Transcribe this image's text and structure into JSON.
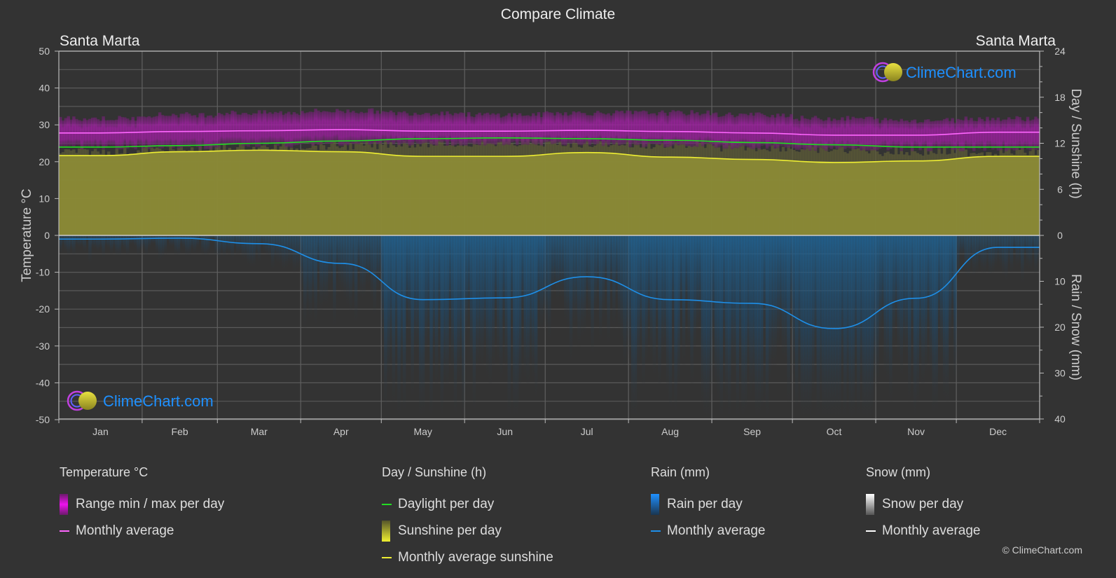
{
  "header": {
    "title": "Compare Climate",
    "location_left": "Santa Marta",
    "location_right": "Santa Marta"
  },
  "watermark": {
    "text": "ClimeChart.com"
  },
  "copyright": "© ClimeChart.com",
  "colors": {
    "background": "#333333",
    "temp_range": "#c21cc4",
    "temp_avg": "#ff66ff",
    "daylight": "#22dd22",
    "sunshine_fill": "#8b8a36",
    "sunshine_avg": "#eeee33",
    "rain_fill": "#1f5f8f",
    "rain_avg": "#1e8fe8",
    "snow_avg": "#ffffff",
    "brand_blue": "#1e90ff"
  },
  "legend": {
    "temperature": {
      "title": "Temperature °C",
      "items": [
        "Range min / max per day",
        "Monthly average"
      ]
    },
    "sunshine": {
      "title": "Day / Sunshine (h)",
      "items": [
        "Daylight per day",
        "Sunshine per day",
        "Monthly average sunshine"
      ]
    },
    "rain": {
      "title": "Rain (mm)",
      "items": [
        "Rain per day",
        "Monthly average"
      ]
    },
    "snow": {
      "title": "Snow (mm)",
      "items": [
        "Snow per day",
        "Monthly average"
      ]
    }
  },
  "chart_data": {
    "type": "line",
    "title": "Compare Climate",
    "categories": [
      "Jan",
      "Feb",
      "Mar",
      "Apr",
      "May",
      "Jun",
      "Jul",
      "Aug",
      "Sep",
      "Oct",
      "Nov",
      "Dec"
    ],
    "axes": {
      "left": {
        "label": "Temperature °C",
        "range": [
          -50,
          50
        ],
        "ticks": [
          50,
          40,
          30,
          20,
          10,
          0,
          -10,
          -20,
          -30,
          -40,
          -50
        ]
      },
      "right_top": {
        "label": "Day / Sunshine (h)",
        "range": [
          0,
          24
        ],
        "ticks": [
          24,
          18,
          12,
          6,
          0
        ]
      },
      "right_bottom": {
        "label": "Rain / Snow (mm)",
        "range": [
          0,
          40
        ],
        "ticks": [
          10,
          20,
          30,
          40
        ]
      }
    },
    "grid": true,
    "legend_position": "bottom",
    "series": [
      {
        "name": "Temperature monthly average (°C)",
        "axis": "left",
        "values": [
          27.8,
          28.2,
          28.4,
          28.7,
          28.3,
          28.3,
          28.5,
          28.2,
          27.8,
          27.2,
          27.2,
          28.0
        ]
      },
      {
        "name": "Temperature daily max (approx °C)",
        "axis": "left",
        "values": [
          31.5,
          32.5,
          33.0,
          33.5,
          33.0,
          32.5,
          33.0,
          33.0,
          32.5,
          31.5,
          31.0,
          31.5
        ]
      },
      {
        "name": "Temperature daily min (approx °C)",
        "axis": "left",
        "values": [
          24.5,
          24.5,
          25.0,
          25.5,
          25.5,
          25.5,
          25.5,
          25.0,
          24.5,
          24.0,
          24.0,
          24.0
        ]
      },
      {
        "name": "Daylight per day (h)",
        "axis": "right_top",
        "values": [
          11.5,
          11.7,
          12.0,
          12.3,
          12.6,
          12.7,
          12.6,
          12.4,
          12.1,
          11.8,
          11.5,
          11.5
        ]
      },
      {
        "name": "Monthly average sunshine (h)",
        "axis": "right_top",
        "values": [
          10.4,
          10.9,
          11.1,
          10.9,
          10.3,
          10.3,
          10.8,
          10.2,
          9.9,
          9.5,
          9.7,
          10.3
        ]
      },
      {
        "name": "Rain monthly average (mm)",
        "axis": "right_bottom",
        "values": [
          0.8,
          0.6,
          1.8,
          6.1,
          14.0,
          13.6,
          9.0,
          14.0,
          14.8,
          20.3,
          13.7,
          2.6
        ]
      },
      {
        "name": "Snow monthly average (mm)",
        "axis": "right_bottom",
        "values": [
          0,
          0,
          0,
          0,
          0,
          0,
          0,
          0,
          0,
          0,
          0,
          0
        ]
      }
    ]
  }
}
